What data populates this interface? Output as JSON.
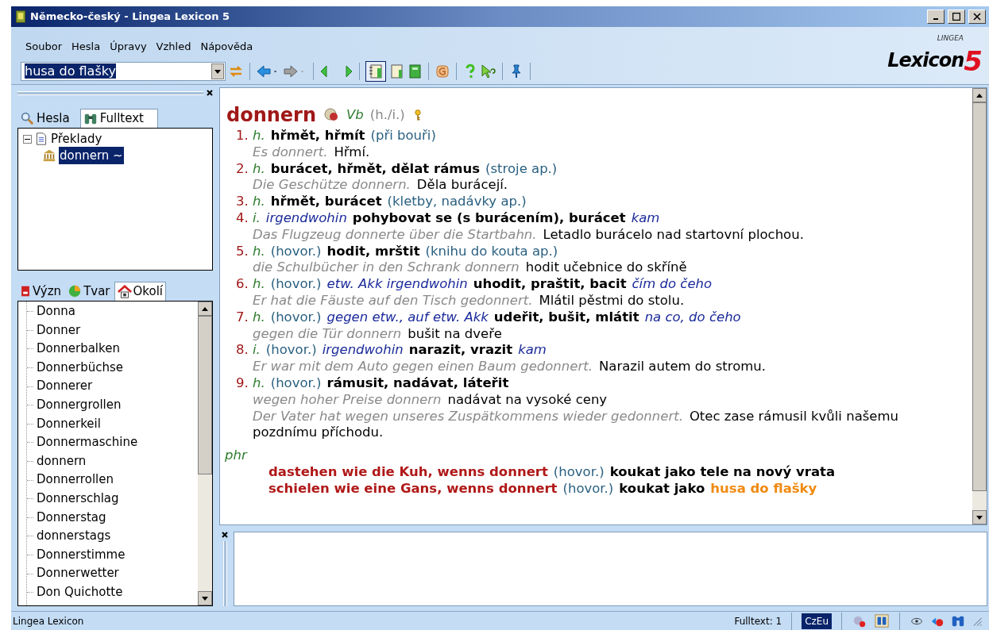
{
  "window": {
    "title": "Německo-český - Lingea Lexicon 5"
  },
  "menu": [
    "Soubor",
    "Hesla",
    "Úpravy",
    "Vzhled",
    "Nápověda"
  ],
  "search": {
    "value": "husa do flašky"
  },
  "logo": {
    "text": "Lexicon",
    "number": "5",
    "maker": "LINGEA"
  },
  "top_tabs": [
    {
      "label": "Hesla",
      "selected": false
    },
    {
      "label": "Fulltext",
      "selected": true
    }
  ],
  "tree": [
    {
      "label": "Překlady",
      "expanded": true,
      "selected": false,
      "children": [
        {
          "label": "donnern ~",
          "selected": true
        }
      ]
    }
  ],
  "bottom_tabs": [
    {
      "label": "Význ",
      "selected": false
    },
    {
      "label": "Tvar",
      "selected": false
    },
    {
      "label": "Okolí",
      "selected": true
    }
  ],
  "neighbors": [
    "Donna",
    "Donner",
    "Donnerbalken",
    "Donnerbüchse",
    "Donnerer",
    "Donnergrollen",
    "Donnerkeil",
    "Donnermaschine",
    "donnern",
    "Donnerrollen",
    "Donnerschlag",
    "Donnerstag",
    "donnerstags",
    "Donnerstimme",
    "Donnerwetter",
    "Don Quichotte"
  ],
  "entry": {
    "headword": "donnern",
    "pos": "Vb",
    "aux": "(h./i.)",
    "senses": [
      {
        "number": "1.",
        "parts": [
          {
            "kind": "gram",
            "text": "h."
          },
          {
            "kind": "trans",
            "text": "hřmět, hřmít"
          },
          {
            "kind": "note",
            "text": "(při bouři)"
          }
        ],
        "examples": [
          {
            "de": "Es donnert.",
            "cs": "Hřmí."
          }
        ]
      },
      {
        "number": "2.",
        "parts": [
          {
            "kind": "gram",
            "text": "h."
          },
          {
            "kind": "trans",
            "text": "burácet, hřmět, dělat rámus"
          },
          {
            "kind": "note",
            "text": "(stroje ap.)"
          }
        ],
        "examples": [
          {
            "de": "Die Geschütze donnern.",
            "cs": "Děla burácejí."
          }
        ]
      },
      {
        "number": "3.",
        "parts": [
          {
            "kind": "gram",
            "text": "h."
          },
          {
            "kind": "trans",
            "text": "hřmět, burácet"
          },
          {
            "kind": "note",
            "text": "(kletby, nadávky ap.)"
          }
        ]
      },
      {
        "number": "4.",
        "parts": [
          {
            "kind": "gram",
            "text": "i."
          },
          {
            "kind": "colloc",
            "text": "irgendwohin"
          },
          {
            "kind": "trans",
            "text": "pohybovat se (s burácením), burácet"
          },
          {
            "kind": "colloc",
            "text": "kam"
          }
        ],
        "examples": [
          {
            "de": "Das Flugzeug donnerte über die Startbahn.",
            "cs": "Letadlo burácelo nad startovní plochou."
          }
        ]
      },
      {
        "number": "5.",
        "parts": [
          {
            "kind": "gram",
            "text": "h."
          },
          {
            "kind": "note",
            "text": "(hovor.)"
          },
          {
            "kind": "trans",
            "text": "hodit, mrštit"
          },
          {
            "kind": "note",
            "text": "(knihu do kouta ap.)"
          }
        ],
        "examples": [
          {
            "de": "die Schulbücher in den Schrank donnern",
            "cs": "hodit učebnice do skříně"
          }
        ]
      },
      {
        "number": "6.",
        "parts": [
          {
            "kind": "gram",
            "text": "h."
          },
          {
            "kind": "note",
            "text": "(hovor.)"
          },
          {
            "kind": "colloc",
            "text": "etw. Akk irgendwohin"
          },
          {
            "kind": "trans",
            "text": "uhodit, praštit, bacit"
          },
          {
            "kind": "colloc",
            "text": "čím do čeho"
          }
        ],
        "examples": [
          {
            "de": "Er hat die Fäuste auf den Tisch gedonnert.",
            "cs": "Mlátil pěstmi do stolu."
          }
        ]
      },
      {
        "number": "7.",
        "parts": [
          {
            "kind": "gram",
            "text": "h."
          },
          {
            "kind": "note",
            "text": "(hovor.)"
          },
          {
            "kind": "colloc",
            "text": "gegen etw., auf etw. Akk"
          },
          {
            "kind": "trans",
            "text": "udeřit, bušit, mlátit"
          },
          {
            "kind": "colloc",
            "text": "na co, do čeho"
          }
        ],
        "examples": [
          {
            "de": "gegen die Tür donnern",
            "cs": "bušit na dveře"
          }
        ]
      },
      {
        "number": "8.",
        "parts": [
          {
            "kind": "gram",
            "text": "i."
          },
          {
            "kind": "note",
            "text": "(hovor.)"
          },
          {
            "kind": "colloc",
            "text": "irgendwohin"
          },
          {
            "kind": "trans",
            "text": "narazit, vrazit"
          },
          {
            "kind": "colloc",
            "text": "kam"
          }
        ],
        "examples": [
          {
            "de": "Er war mit dem Auto gegen einen Baum gedonnert.",
            "cs": "Narazil autem do stromu."
          }
        ]
      },
      {
        "number": "9.",
        "parts": [
          {
            "kind": "gram",
            "text": "h."
          },
          {
            "kind": "note",
            "text": "(hovor.)"
          },
          {
            "kind": "trans",
            "text": "rámusit, nadávat, láteřit"
          }
        ],
        "examples": [
          {
            "de": "wegen hoher Preise donnern",
            "cs": "nadávat na vysoké ceny"
          },
          {
            "de": "Der Vater hat wegen unseres Zuspätkommens wieder gedonnert.",
            "cs": "Otec zase rámusil kvůli našemu pozdnímu příchodu."
          }
        ]
      }
    ],
    "phrase_label": "phr",
    "phrases": [
      {
        "parts": [
          {
            "kind": "phrase",
            "text": "dastehen wie die Kuh, wenns donnert"
          },
          {
            "kind": "note",
            "text": "(hovor.)"
          },
          {
            "kind": "trans",
            "text": "koukat jako tele na nový vrata"
          }
        ]
      },
      {
        "parts": [
          {
            "kind": "phrase",
            "text": "schielen wie eine Gans, wenns donnert"
          },
          {
            "kind": "note",
            "text": "(hovor.)"
          },
          {
            "kind": "trans",
            "text": "koukat jako"
          },
          {
            "kind": "match",
            "text": "husa do flašky"
          }
        ]
      }
    ]
  },
  "status_bar": {
    "app": "Lingea Lexicon",
    "fulltext": "Fulltext: 1",
    "keyboard": "CzEu",
    "keyboard_active": true
  }
}
